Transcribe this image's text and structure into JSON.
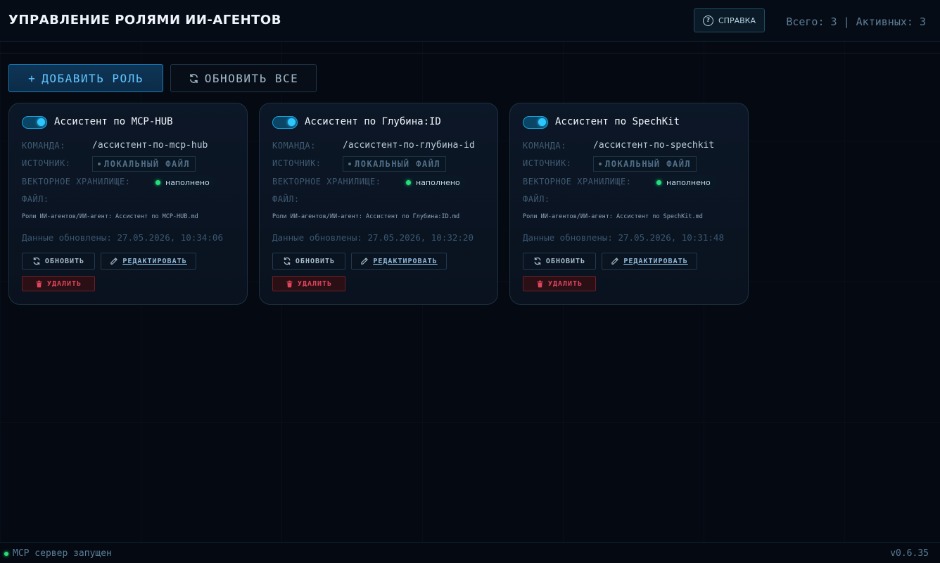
{
  "header": {
    "title": "УПРАВЛЕНИЕ РОЛЯМИ ИИ-АГЕНТОВ",
    "help_label": "СПРАВКА",
    "help_icon": "?",
    "stats": "Всего: 3 | Активных: 3"
  },
  "toolbar": {
    "add_label": "ДОБАВИТЬ РОЛЬ",
    "add_icon": "+",
    "refresh_all_label": "ОБНОВИТЬ ВСЕ"
  },
  "labels": {
    "command": "КОМАНДА:",
    "source": "ИСТОЧНИК:",
    "vector_store": "ВЕКТОРНОЕ ХРАНИЛИЩЕ:",
    "file": "ФАЙЛ:",
    "refresh": "ОБНОВИТЬ",
    "edit": "РЕДАКТИРОВАТЬ",
    "delete": "УДАЛИТЬ"
  },
  "roles": [
    {
      "title": "Ассистент по MCP-HUB",
      "enabled": true,
      "command": "/ассистент-по-mcp-hub",
      "source": "ЛОКАЛЬНЫЙ ФАЙЛ",
      "vector_status": "наполнено",
      "file_path": "Роли ИИ-агентов/ИИ-агент: Ассистент по MCP-HUB.md",
      "updated": "Данные обновлены: 27.05.2026, 10:34:06"
    },
    {
      "title": "Ассистент по Глубина:ID",
      "enabled": true,
      "command": "/ассистент-по-глубина-id",
      "source": "ЛОКАЛЬНЫЙ ФАЙЛ",
      "vector_status": "наполнено",
      "file_path": "Роли ИИ-агентов/ИИ-агент: Ассистент по Глубина:ID.md",
      "updated": "Данные обновлены: 27.05.2026, 10:32:20"
    },
    {
      "title": "Ассистент по SpechKit",
      "enabled": true,
      "command": "/ассистент-по-spechkit",
      "source": "ЛОКАЛЬНЫЙ ФАЙЛ",
      "vector_status": "наполнено",
      "file_path": "Роли ИИ-агентов/ИИ-агент: Ассистент по SpechKit.md",
      "updated": "Данные обновлены: 27.05.2026, 10:31:48"
    }
  ],
  "footer": {
    "status": "MCP сервер запущен",
    "version": "v0.6.35"
  },
  "colors": {
    "accent": "#2ec6ff",
    "success": "#24e07a",
    "danger": "#e0455c",
    "background": "#050a12"
  }
}
